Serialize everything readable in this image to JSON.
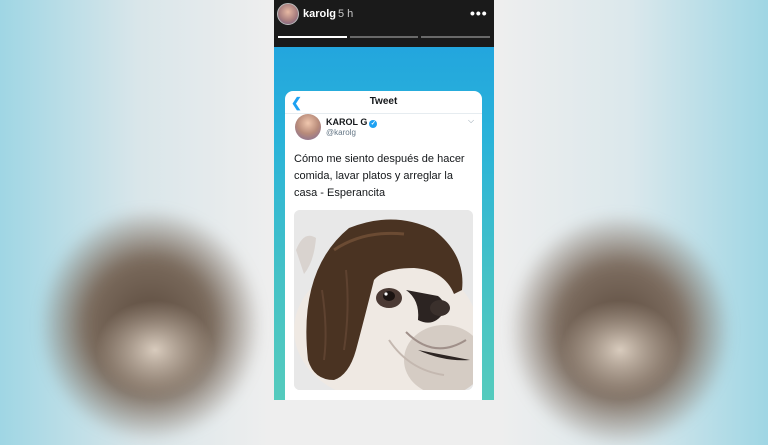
{
  "story": {
    "username": "karolg",
    "time": "5 h",
    "more_icon": "more-horizontal-icon",
    "progress_segments": 3,
    "progress_done": 1
  },
  "tweet": {
    "header_title": "Tweet",
    "back_icon": "chevron-left-icon",
    "author_name": "KAROL G",
    "author_handle": "@karolg",
    "verified_icon": "verified-badge-icon",
    "text": "Cómo me siento después de hacer comida, lavar platos y arreglar la casa  - Esperancita"
  },
  "colors": {
    "accent": "#1da1f2",
    "story_header": "#1a1a1a"
  }
}
